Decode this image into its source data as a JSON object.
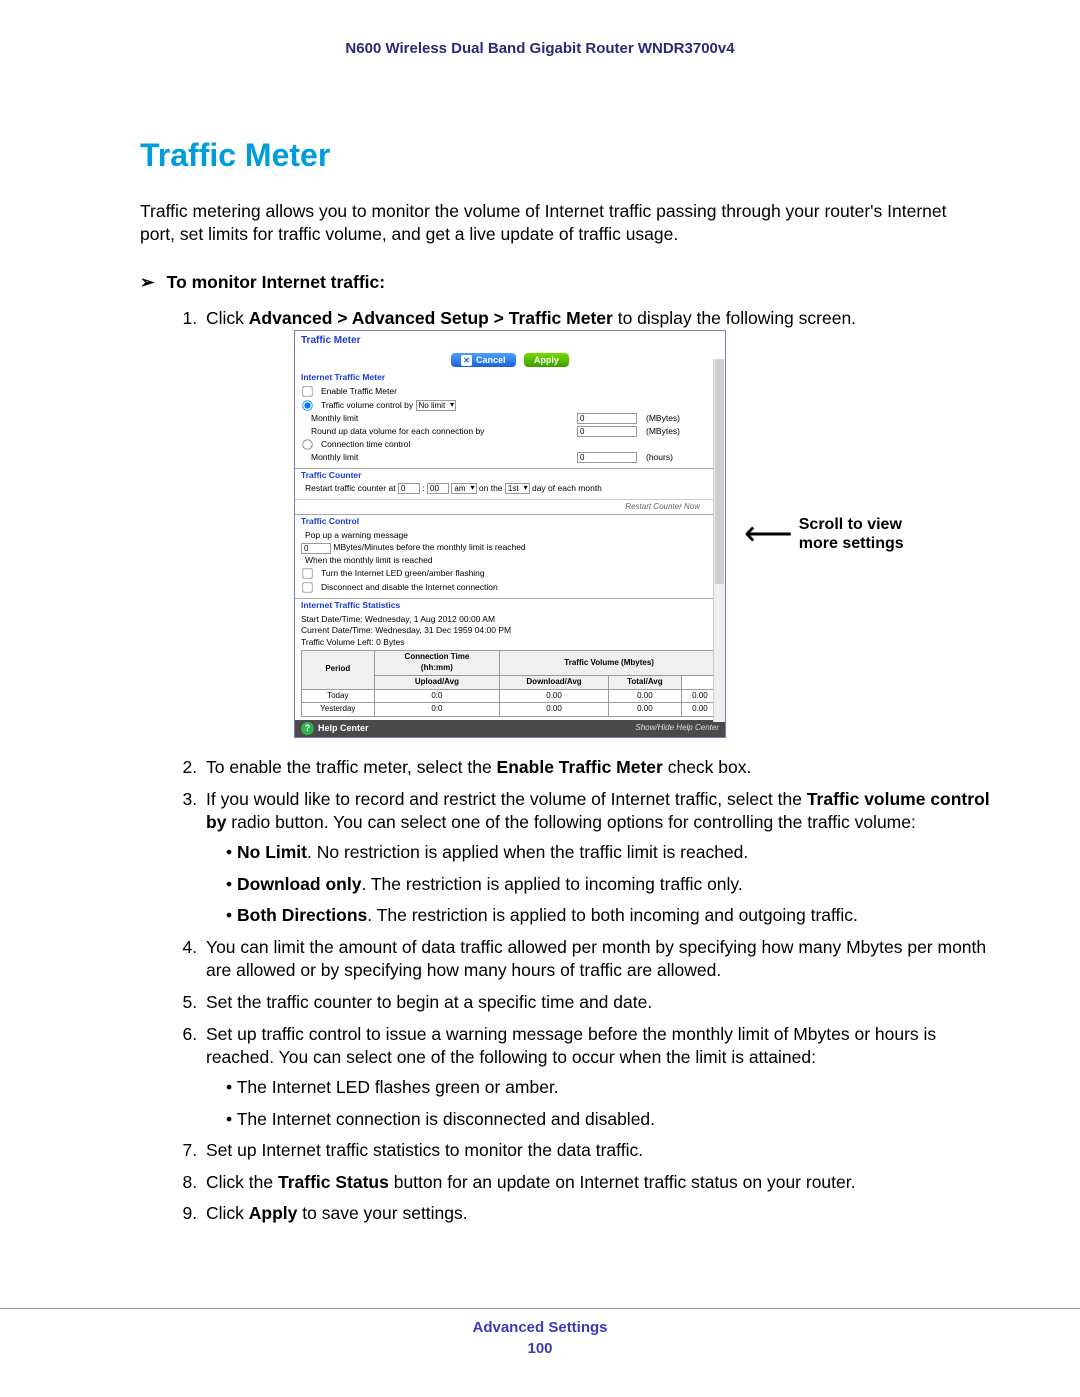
{
  "header": {
    "product": "N600 Wireless Dual Band Gigabit Router WNDR3700v4"
  },
  "section": {
    "title": "Traffic Meter"
  },
  "intro": "Traffic metering allows you to monitor the volume of Internet traffic passing through your router's Internet port, set limits for traffic volume, and get a live update of traffic usage.",
  "task": {
    "arrow": "➢",
    "heading": "To monitor Internet traffic:"
  },
  "steps": {
    "s1a": "Click ",
    "s1b": "Advanced > Advanced Setup > Traffic Meter",
    "s1c": " to display the following screen.",
    "s2a": "To enable the traffic meter, select the ",
    "s2b": "Enable Traffic Meter",
    "s2c": " check box.",
    "s3a": "If you would like to record and restrict the volume of Internet traffic, select the ",
    "s3b": "Traffic volume control by",
    "s3c": " radio button. You can select one of the following options for controlling the traffic volume:",
    "s3_b1a": "No Limit",
    "s3_b1b": ". No restriction is applied when the traffic limit is reached.",
    "s3_b2a": "Download only",
    "s3_b2b": ". The restriction is applied to incoming traffic only.",
    "s3_b3a": "Both Directions",
    "s3_b3b": ". The restriction is applied to both incoming and outgoing traffic.",
    "s4": "You can limit the amount of data traffic allowed per month by specifying how many Mbytes per month are allowed or by specifying how many hours of traffic are allowed.",
    "s5": "Set the traffic counter to begin at a specific time and date.",
    "s6": "Set up traffic control to issue a warning message before the monthly limit of Mbytes or hours is reached. You can select one of the following to occur when the limit is attained:",
    "s6_b1": "The Internet LED flashes green or amber.",
    "s6_b2": "The Internet connection is disconnected and disabled.",
    "s7": "Set up Internet traffic statistics to monitor the data traffic.",
    "s8a": "Click the ",
    "s8b": "Traffic Status",
    "s8c": " button for an update on Internet traffic status on your router.",
    "s9a": "Click ",
    "s9b": "Apply",
    "s9c": " to save your settings."
  },
  "annot": {
    "scroll1": "Scroll to view",
    "scroll2": "more settings"
  },
  "shot": {
    "title": "Traffic Meter",
    "btn_cancel": "Cancel",
    "btn_apply": "Apply",
    "sec1_h": "Internet Traffic Meter",
    "cb_enable": "Enable Traffic Meter",
    "rb_vol_lbl": "Traffic volume control by",
    "sel_nolimit": "No limit",
    "ml_lbl": "Monthly limit",
    "ml_val": "0",
    "ml_unit": "(MBytes)",
    "round_lbl": "Round up data volume for each connection by",
    "round_val": "0",
    "round_unit": "(MBytes)",
    "rb_time_lbl": "Connection time control",
    "ml2_lbl": "Monthly limit",
    "ml2_val": "0",
    "ml2_unit": "(hours)",
    "sec2_h": "Traffic Counter",
    "restart_lbl": "Restart traffic counter at",
    "restart_hh": "0",
    "restart_mm": "00",
    "restart_ampm": "am",
    "restart_on": "on the",
    "restart_day": "1st",
    "restart_end": "day of each month",
    "restart_btn": "Restart Counter Now",
    "sec3_h": "Traffic Control",
    "popup_lbl": "Pop up a warning message",
    "warn_val": "0",
    "warn_tail": "MBytes/Minutes before the monthly limit is reached",
    "when_lbl": "When the monthly limit is reached",
    "cb_led": "Turn the Internet LED green/amber flashing",
    "cb_disc": "Disconnect and disable the Internet connection",
    "sec4_h": "Internet Traffic Statistics",
    "stat_start": "Start Date/Time: Wednesday, 1 Aug 2012 00:00 AM",
    "stat_curr": "Current Date/Time: Wednesday, 31 Dec 1959 04:00 PM",
    "stat_left": "Traffic Volume Left: 0 Bytes",
    "th_period": "Period",
    "th_conn": "Connection Time",
    "th_connsub": "(hh:mm)",
    "th_vol": "Traffic Volume (Mbytes)",
    "th_up": "Upload/Avg",
    "th_down": "Download/Avg",
    "th_total": "Total/Avg",
    "row_today": "Today",
    "row_yest": "Yesterday",
    "v00": "0:0",
    "v000": "0.00",
    "help": "Help Center",
    "help_sh": "Show/Hide Help Center"
  },
  "footer": {
    "name": "Advanced Settings",
    "page": "100"
  }
}
